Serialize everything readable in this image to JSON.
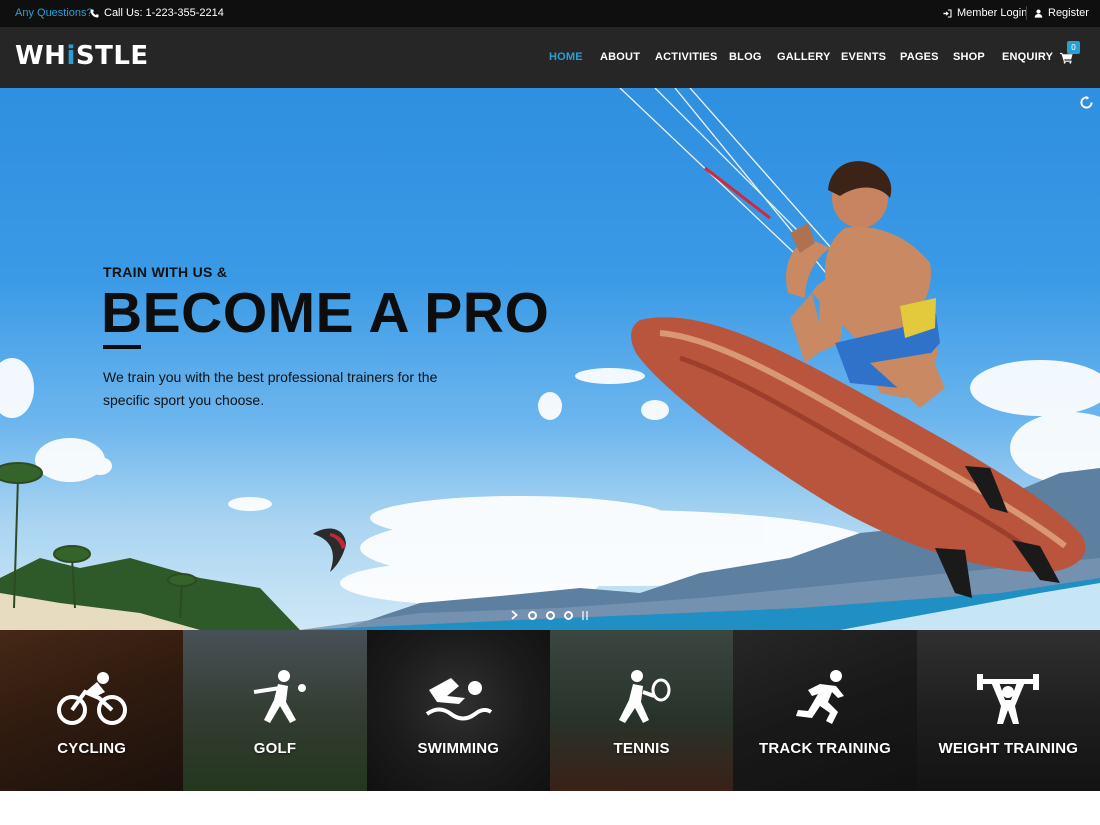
{
  "topbar": {
    "question": "Any Questions?",
    "call": "Call Us: 1-223-355-2214",
    "login": "Member Login",
    "register": "Register"
  },
  "brand": {
    "logo_pre": "WH",
    "logo_accent": "i",
    "logo_post": "STLE",
    "accent_color": "#2a9fd6"
  },
  "nav": {
    "items": [
      "HOME",
      "ABOUT",
      "ACTIVITIES",
      "BLOG",
      "GALLERY",
      "EVENTS",
      "PAGES",
      "SHOP",
      "ENQUIRY"
    ],
    "active": "HOME",
    "cart_count": "0"
  },
  "hero": {
    "kicker": "TRAIN WITH US &",
    "title": "BECOME A PRO",
    "description": "We train you with the best professional trainers for the specific sport you choose.",
    "slides": 3
  },
  "sports": [
    {
      "label": "CYCLING",
      "icon": "cycling-icon"
    },
    {
      "label": "GOLF",
      "icon": "golf-icon"
    },
    {
      "label": "SWIMMING",
      "icon": "swimming-icon"
    },
    {
      "label": "TENNIS",
      "icon": "tennis-icon"
    },
    {
      "label": "TRACK TRAINING",
      "icon": "running-icon"
    },
    {
      "label": "WEIGHT TRAINING",
      "icon": "weightlifting-icon"
    }
  ]
}
